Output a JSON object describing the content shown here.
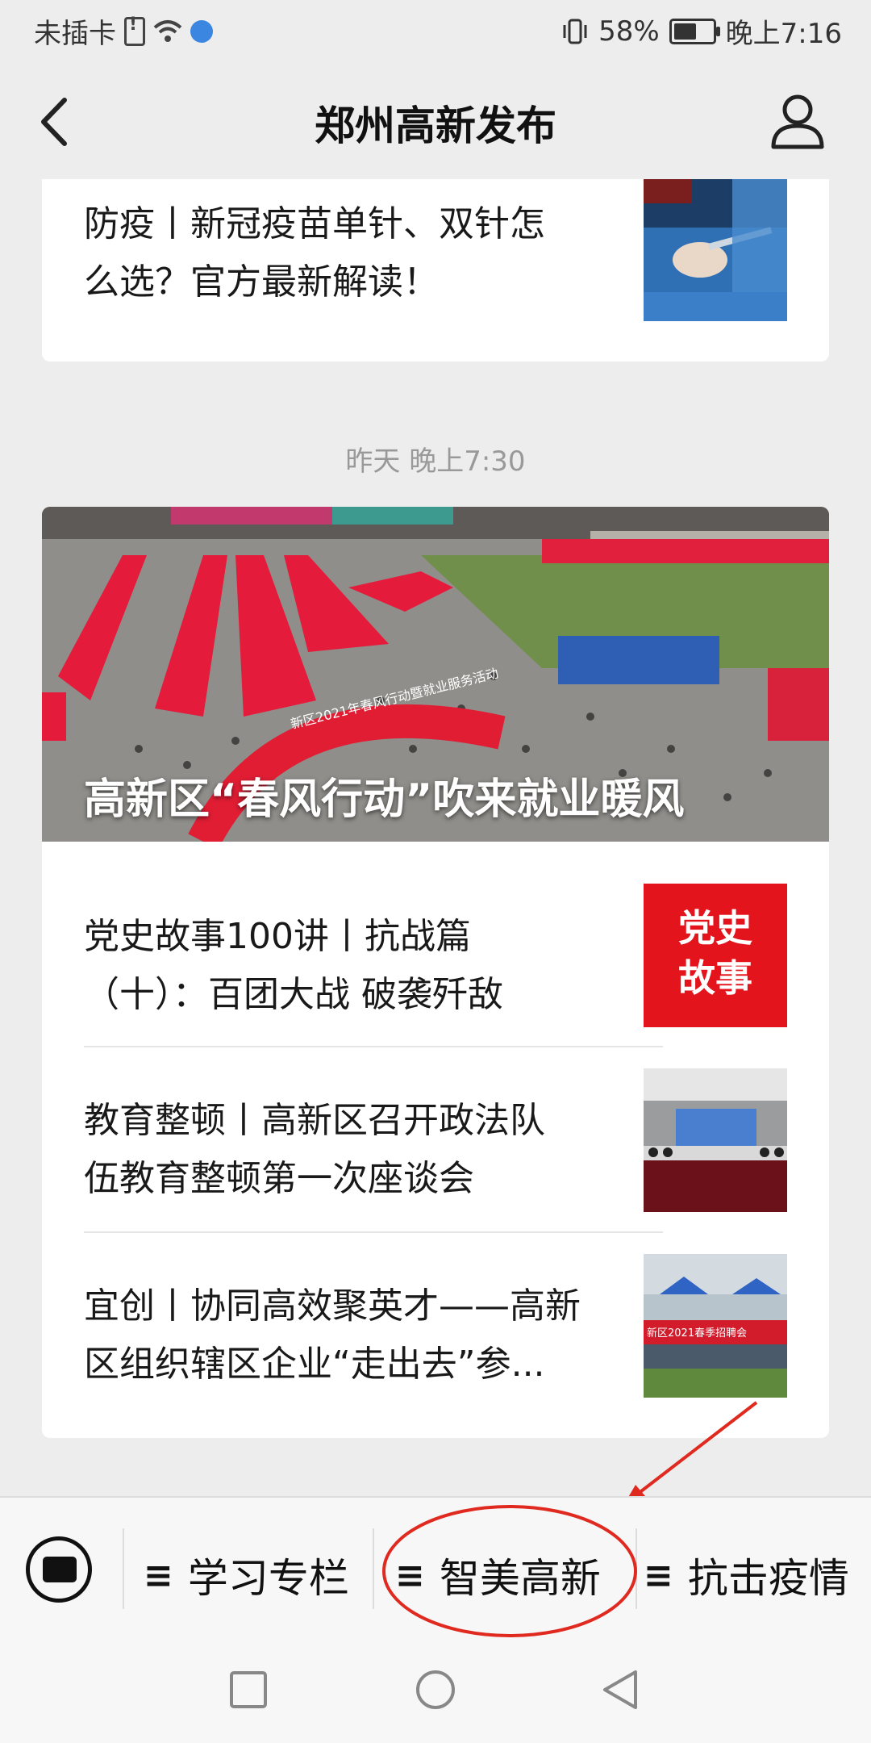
{
  "status_bar": {
    "carrier": "未插卡",
    "battery": "58%",
    "battery_level": 0.58,
    "time": "晚上7:16"
  },
  "nav": {
    "title": "郑州高新发布"
  },
  "feed": {
    "partial_article": {
      "title_line1": "防疫丨新冠疫苗单针、双针怎",
      "title_line2": "么选？官方最新解读！"
    },
    "timestamp": "昨天 晚上7:30",
    "cover": {
      "title": "高新区“春风行动”吹来就业暖风",
      "arch_text": "新区2021年春风行动暨就业服务活动"
    },
    "articles": [
      {
        "line1": "党史故事100讲丨抗战篇",
        "line2": "（十）：百团大战 破袭歼敌",
        "thumb_text1": "党史",
        "thumb_text2": "故事"
      },
      {
        "line1": "教育整顿丨高新区召开政法队",
        "line2": "伍教育整顿第一次座谈会"
      },
      {
        "line1": "宜创丨协同高效聚英才——高新",
        "line2": "区组织辖区企业“走出去”参...",
        "thumb_banner": "新区2021春季招聘会"
      }
    ]
  },
  "menu": {
    "items": [
      {
        "label": "学习专栏"
      },
      {
        "label": "智美高新"
      },
      {
        "label": "抗击疫情"
      }
    ]
  },
  "colors": {
    "annotation_red": "#e02a20",
    "party_red": "#e3141b"
  }
}
